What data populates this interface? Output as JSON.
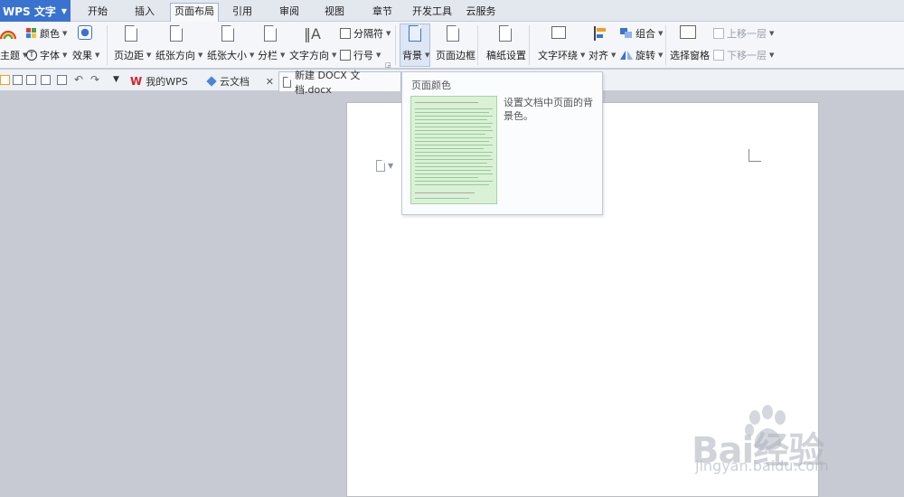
{
  "app": {
    "title": "WPS 文字"
  },
  "menu": {
    "tabs": [
      {
        "label": "开始"
      },
      {
        "label": "插入"
      },
      {
        "label": "页面布局"
      },
      {
        "label": "引用"
      },
      {
        "label": "审阅"
      },
      {
        "label": "视图"
      },
      {
        "label": "章节"
      },
      {
        "label": "开发工具"
      },
      {
        "label": "云服务"
      }
    ],
    "active": "页面布局"
  },
  "ribbon": {
    "theme_label": "主题",
    "color_label": "颜色",
    "font_label": "字体",
    "effect_label": "效果",
    "margin_label": "页边距",
    "orientation_label": "纸张方向",
    "size_label": "纸张大小",
    "columns_label": "分栏",
    "text_direction_label": "文字方向",
    "separator_label": "分隔符",
    "line_number_label": "行号",
    "background_label": "背景",
    "page_border_label": "页面边框",
    "draft_setting_label": "稿纸设置",
    "text_wrap_label": "文字环绕",
    "align_label": "对齐",
    "group_label": "组合",
    "rotate_label": "旋转",
    "selection_pane_label": "选择窗格",
    "bring_forward_label": "上移一层",
    "send_backward_label": "下移一层"
  },
  "tabs": {
    "items": [
      {
        "label": "我的WPS"
      },
      {
        "label": "云文档"
      },
      {
        "label": "新建 DOCX 文档.docx"
      }
    ]
  },
  "tooltip": {
    "title": "页面颜色",
    "description": "设置文档中页面的背景色。"
  },
  "watermark": {
    "text": "Bai经验",
    "url": "jingyan.baidu.com"
  },
  "colors": {
    "accent": "#3973cf",
    "ribbon_bg": "#f4f6f9",
    "workspace_bg": "#c7cad3",
    "preview_green": "#d9f2d6"
  }
}
